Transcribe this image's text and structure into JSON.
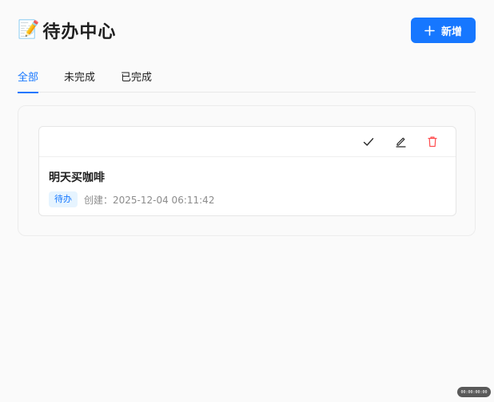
{
  "header": {
    "emoji": "📝",
    "title": "待办中心",
    "add_button_label": "新增",
    "add_icon": "plus-icon"
  },
  "tabs": [
    {
      "label": "全部",
      "active": true
    },
    {
      "label": "未完成",
      "active": false
    },
    {
      "label": "已完成",
      "active": false
    }
  ],
  "todos": [
    {
      "title": "明天买咖啡",
      "status": "待办",
      "created": "创建：2025-12-04 06:11:42",
      "actions": [
        "check-icon",
        "edit-icon",
        "delete-icon"
      ]
    }
  ],
  "timer": "00:00:00:00",
  "colors": {
    "accent": "#1677ff",
    "delete": "#ff4d4f",
    "badge_bg": "#e6f4ff"
  }
}
